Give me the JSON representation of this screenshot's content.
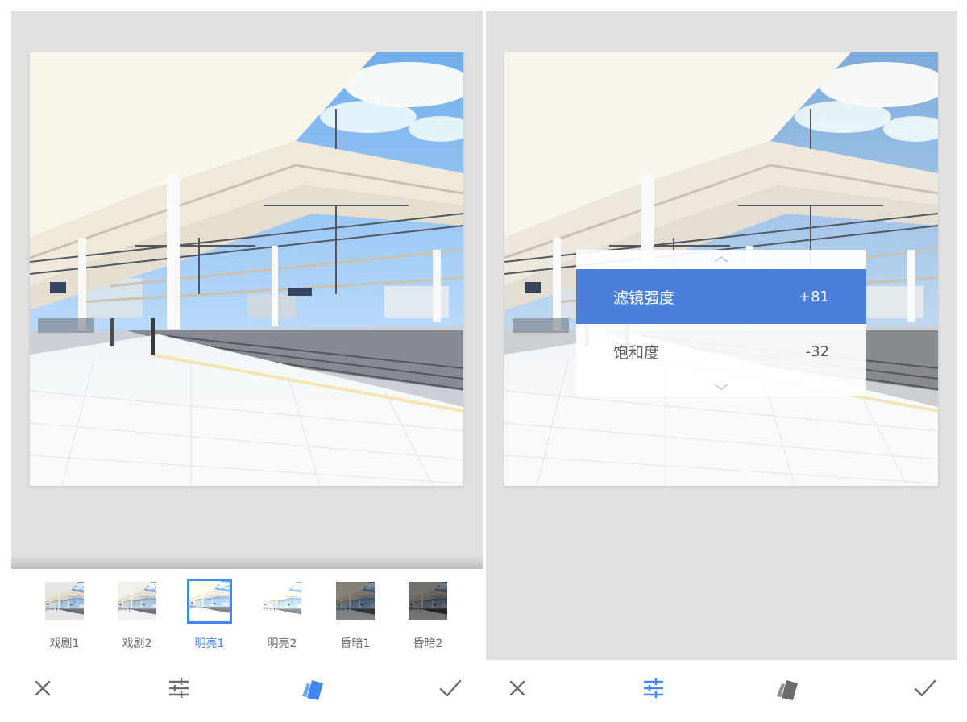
{
  "left_screen": {
    "filters": [
      {
        "label": "戏剧1",
        "selected": false,
        "tone": "drama"
      },
      {
        "label": "戏剧2",
        "selected": false,
        "tone": "drama"
      },
      {
        "label": "明亮1",
        "selected": true,
        "tone": "bright"
      },
      {
        "label": "明亮2",
        "selected": false,
        "tone": "bright"
      },
      {
        "label": "昏暗1",
        "selected": false,
        "tone": "dark"
      },
      {
        "label": "昏暗2",
        "selected": false,
        "tone": "dark"
      }
    ],
    "toolbar": {
      "cancel_icon": "close-icon",
      "adjust_icon": "sliders-icon",
      "style_icon": "style-card-icon",
      "apply_icon": "check-icon",
      "active_tool": "style"
    }
  },
  "right_screen": {
    "adjust_menu": {
      "items": [
        {
          "label": "滤镜强度",
          "value": "+81",
          "active": true
        },
        {
          "label": "饱和度",
          "value": "-32",
          "active": false
        }
      ]
    },
    "toolbar": {
      "cancel_icon": "close-icon",
      "adjust_icon": "sliders-icon",
      "style_icon": "style-card-icon",
      "apply_icon": "check-icon",
      "active_tool": "adjust"
    }
  },
  "colors": {
    "accent": "#4285f4",
    "menu_active": "#4a7fdc",
    "canvas_bg": "#e0e0e0",
    "icon_gray": "#6b6b6b"
  }
}
